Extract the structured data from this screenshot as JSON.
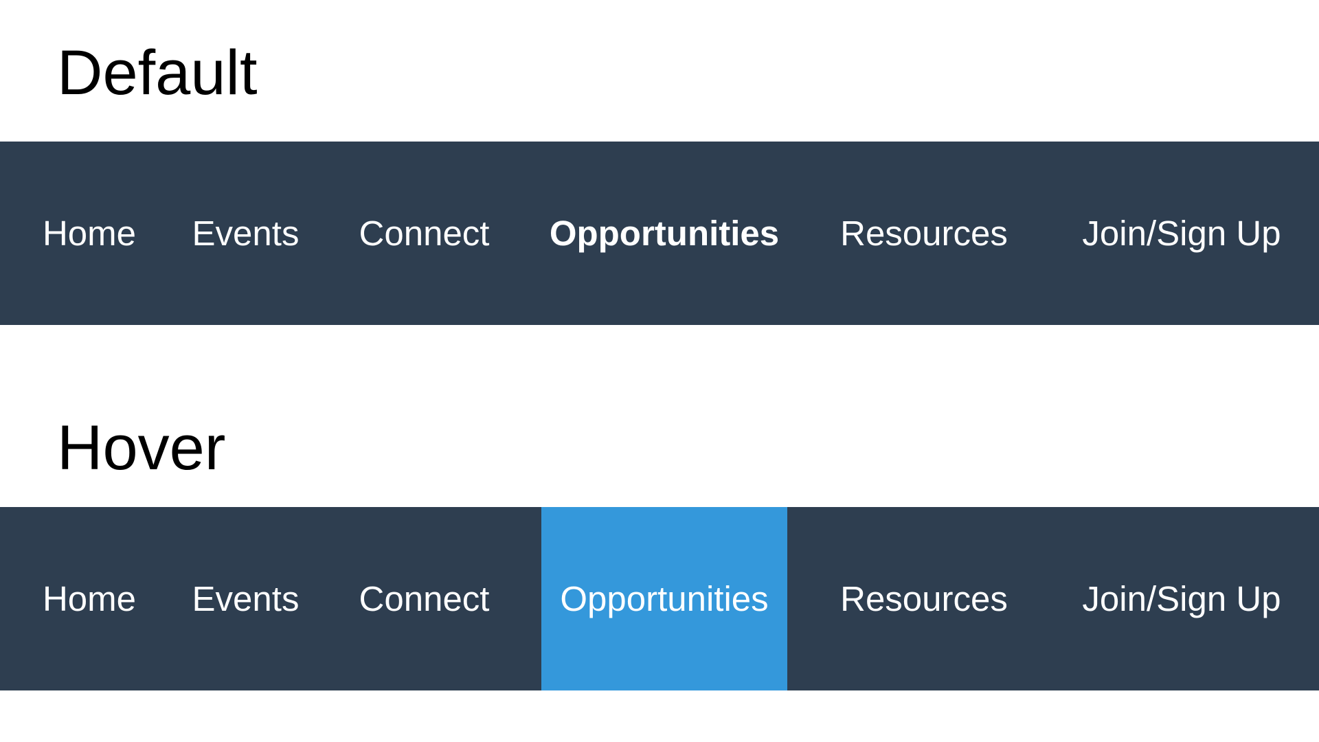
{
  "sections": [
    {
      "heading": "Default",
      "nav": {
        "items": [
          {
            "label": "Home"
          },
          {
            "label": "Events"
          },
          {
            "label": "Connect"
          },
          {
            "label": "Opportunities"
          },
          {
            "label": "Resources"
          },
          {
            "label": "Join/Sign Up"
          }
        ],
        "highlighted_item": "Opportunities",
        "highlight_style": "bold"
      }
    },
    {
      "heading": "Hover",
      "nav": {
        "items": [
          {
            "label": "Home"
          },
          {
            "label": "Events"
          },
          {
            "label": "Connect"
          },
          {
            "label": "Opportunities"
          },
          {
            "label": "Resources"
          },
          {
            "label": "Join/Sign Up"
          }
        ],
        "highlighted_item": "Opportunities",
        "highlight_style": "background"
      }
    }
  ],
  "colors": {
    "nav_background": "#2e3e50",
    "hover_background": "#3498db",
    "nav_text": "#ffffff",
    "heading_text": "#000000",
    "page_background": "#ffffff"
  }
}
